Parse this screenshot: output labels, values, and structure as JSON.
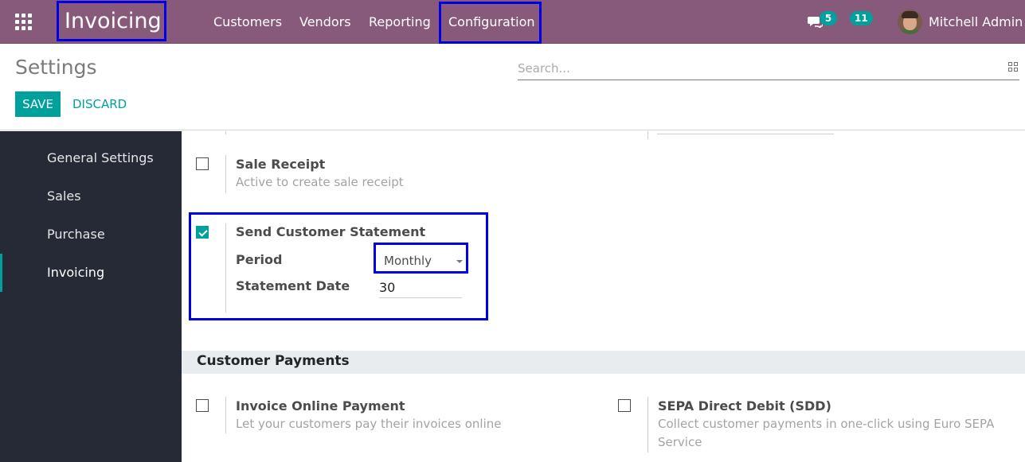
{
  "topbar": {
    "app_name": "Invoicing",
    "menu": [
      "Customers",
      "Vendors",
      "Reporting",
      "Configuration"
    ],
    "messages_count": "5",
    "activities_count": "11",
    "user_name": "Mitchell Admin"
  },
  "control": {
    "title": "Settings",
    "search_placeholder": "Search...",
    "save_label": "SAVE",
    "discard_label": "DISCARD"
  },
  "sidebar": {
    "items": [
      {
        "label": "General Settings"
      },
      {
        "label": "Sales"
      },
      {
        "label": "Purchase"
      },
      {
        "label": "Invoicing"
      }
    ]
  },
  "content": {
    "sale_receipt": {
      "title": "Sale Receipt",
      "description": "Active to create sale receipt",
      "checked": false
    },
    "customer_statement": {
      "title": "Send Customer Statement",
      "checked": true,
      "period_label": "Period",
      "period_value": "Monthly",
      "date_label": "Statement Date",
      "date_value": "30"
    },
    "section_title": "Customer Payments",
    "online_payment": {
      "title": "Invoice Online Payment",
      "description": "Let your customers pay their invoices online",
      "checked": false
    },
    "sepa": {
      "title": "SEPA Direct Debit (SDD)",
      "description": "Collect customer payments in one-click using Euro SEPA Service",
      "checked": false
    }
  },
  "colors": {
    "topbar": "#875a7b",
    "accent": "#00a09d",
    "sidebar": "#262a36",
    "highlight": "#0000e6"
  }
}
